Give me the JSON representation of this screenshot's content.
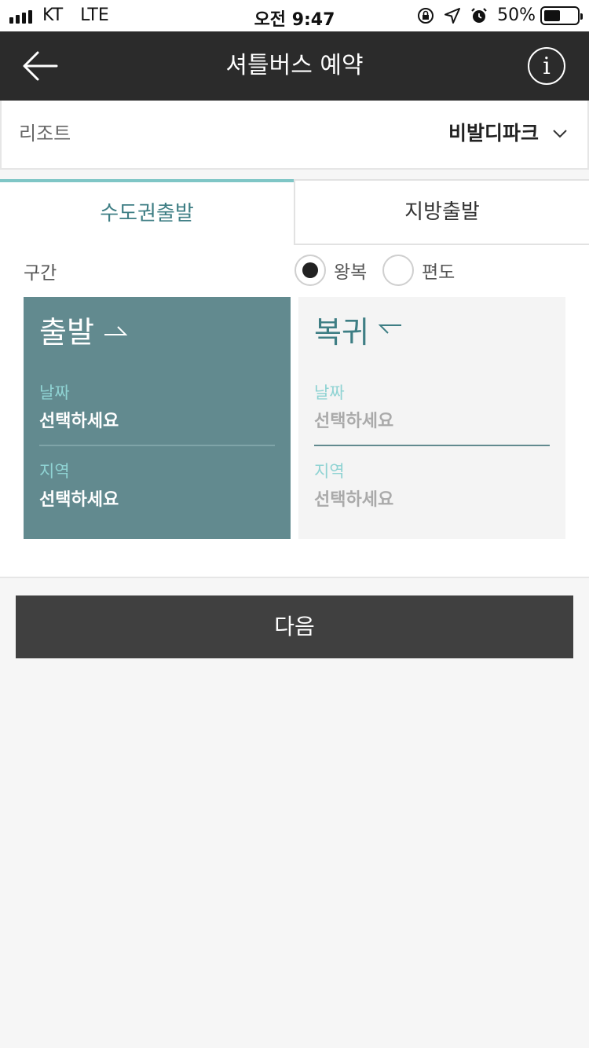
{
  "status_bar": {
    "carrier": "KT",
    "network": "LTE",
    "time": "오전 9:47",
    "battery": "50%",
    "battery_level": 0.5
  },
  "header": {
    "title": "셔틀버스 예약",
    "back_icon": "back-arrow-icon",
    "info_icon": "info-icon",
    "info_glyph": "i"
  },
  "resort": {
    "label": "리조트",
    "value": "비발디파크"
  },
  "tabs": [
    {
      "label": "수도권출발",
      "active": true
    },
    {
      "label": "지방출발",
      "active": false
    }
  ],
  "route": {
    "label": "구간",
    "options": [
      {
        "label": "왕복",
        "selected": true
      },
      {
        "label": "편도",
        "selected": false
      }
    ]
  },
  "departure": {
    "title": "출발",
    "date_label": "날짜",
    "date_value": "선택하세요",
    "region_label": "지역",
    "region_value": "선택하세요"
  },
  "return": {
    "title": "복귀",
    "date_label": "날짜",
    "date_value": "선택하세요",
    "region_label": "지역",
    "region_value": "선택하세요"
  },
  "next_label": "다음",
  "colors": {
    "header_bg": "#2b2b2b",
    "accent": "#628a8f",
    "tab_active": "#3e7e84",
    "label_teal": "#8fd3d3",
    "button_bg": "#404040"
  }
}
